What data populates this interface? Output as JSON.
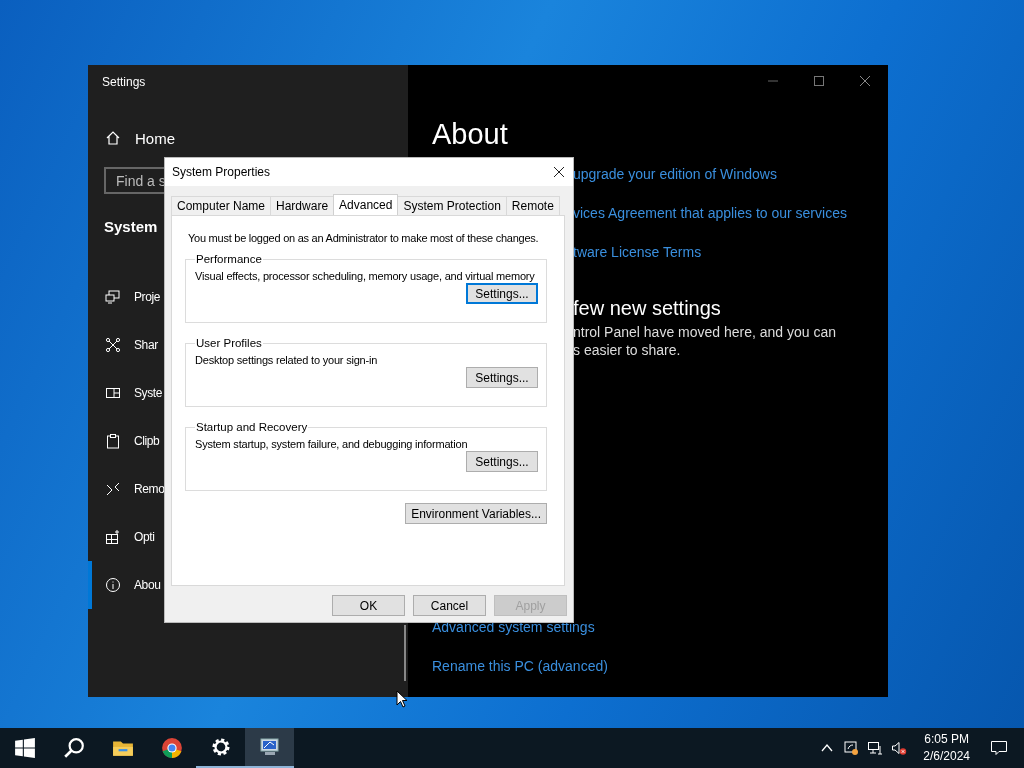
{
  "settings_window": {
    "title": "Settings",
    "sidebar": {
      "home": "Home",
      "search": {
        "placeholder": "Find a s"
      },
      "section": "System",
      "items": [
        {
          "kind": "project",
          "label": "Proje",
          "selected": false
        },
        {
          "kind": "share",
          "label": "Shar",
          "selected": false
        },
        {
          "kind": "system",
          "label": "Syste",
          "selected": false
        },
        {
          "kind": "clipboard",
          "label": "Clipb",
          "selected": false
        },
        {
          "kind": "remote",
          "label": "Remo",
          "selected": false
        },
        {
          "kind": "optional",
          "label": "Opti",
          "selected": false
        },
        {
          "kind": "about",
          "label": "Abou",
          "selected": true
        }
      ]
    },
    "content": {
      "heading": "About",
      "links_top": [
        "upgrade your edition of Windows",
        "vices Agreement that applies to our services",
        "tware License Terms"
      ],
      "subheading": "few new settings",
      "paragraph_lines": [
        "ntrol Panel have moved here, and you can",
        "s easier to share."
      ],
      "links_bottom": [
        "Advanced system settings",
        "Rename this PC (advanced)"
      ]
    }
  },
  "dialog": {
    "title": "System Properties",
    "tabs": [
      {
        "label": "Computer Name",
        "selected": false
      },
      {
        "label": "Hardware",
        "selected": false
      },
      {
        "label": "Advanced",
        "selected": true
      },
      {
        "label": "System Protection",
        "selected": false
      },
      {
        "label": "Remote",
        "selected": false
      }
    ],
    "notice": "You must be logged on as an Administrator to make most of these changes.",
    "groups": [
      {
        "legend": "Performance",
        "description": "Visual effects, processor scheduling, memory usage, and virtual memory",
        "button": {
          "label": "Settings...",
          "default": true
        }
      },
      {
        "legend": "User Profiles",
        "description": "Desktop settings related to your sign-in",
        "button": {
          "label": "Settings...",
          "default": false
        }
      },
      {
        "legend": "Startup and Recovery",
        "description": "System startup, system failure, and debugging information",
        "button": {
          "label": "Settings...",
          "default": false
        }
      }
    ],
    "env_button": "Environment Variables...",
    "buttons": [
      {
        "label": "OK",
        "disabled": false
      },
      {
        "label": "Cancel",
        "disabled": false
      },
      {
        "label": "Apply",
        "disabled": true
      }
    ]
  },
  "taskbar": {
    "apps": [
      {
        "kind": "start",
        "running": false,
        "active": false
      },
      {
        "kind": "search",
        "running": false,
        "active": false
      },
      {
        "kind": "folder",
        "running": false,
        "active": false
      },
      {
        "kind": "browser",
        "running": false,
        "active": false
      },
      {
        "kind": "gear",
        "running": true,
        "active": false
      },
      {
        "kind": "sysprops",
        "running": true,
        "active": true
      }
    ],
    "time": "6:05 PM",
    "date": "2/6/2024"
  }
}
